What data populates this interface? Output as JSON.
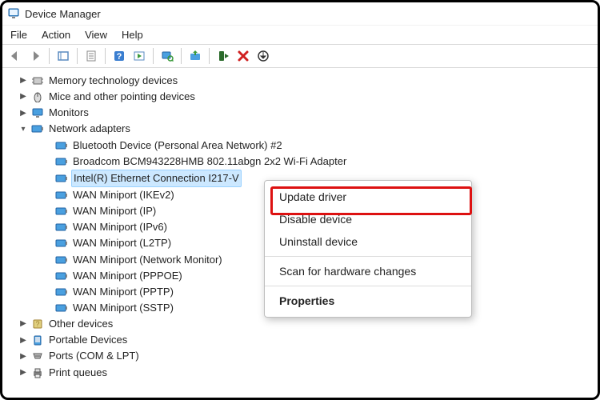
{
  "window": {
    "title": "Device Manager"
  },
  "menus": {
    "file": "File",
    "action": "Action",
    "view": "View",
    "help": "Help"
  },
  "tree": {
    "memory": "Memory technology devices",
    "mice": "Mice and other pointing devices",
    "monitors": "Monitors",
    "network": {
      "label": "Network adapters",
      "items": [
        "Bluetooth Device (Personal Area Network) #2",
        "Broadcom BCM943228HMB 802.11abgn 2x2 Wi-Fi Adapter",
        "Intel(R) Ethernet Connection I217-V",
        "WAN Miniport (IKEv2)",
        "WAN Miniport (IP)",
        "WAN Miniport (IPv6)",
        "WAN Miniport (L2TP)",
        "WAN Miniport (Network Monitor)",
        "WAN Miniport (PPPOE)",
        "WAN Miniport (PPTP)",
        "WAN Miniport (SSTP)"
      ]
    },
    "other": "Other devices",
    "portable": "Portable Devices",
    "ports": "Ports (COM & LPT)",
    "printq": "Print queues"
  },
  "context": {
    "update": "Update driver",
    "disable": "Disable device",
    "uninstall": "Uninstall device",
    "scan": "Scan for hardware changes",
    "properties": "Properties"
  }
}
